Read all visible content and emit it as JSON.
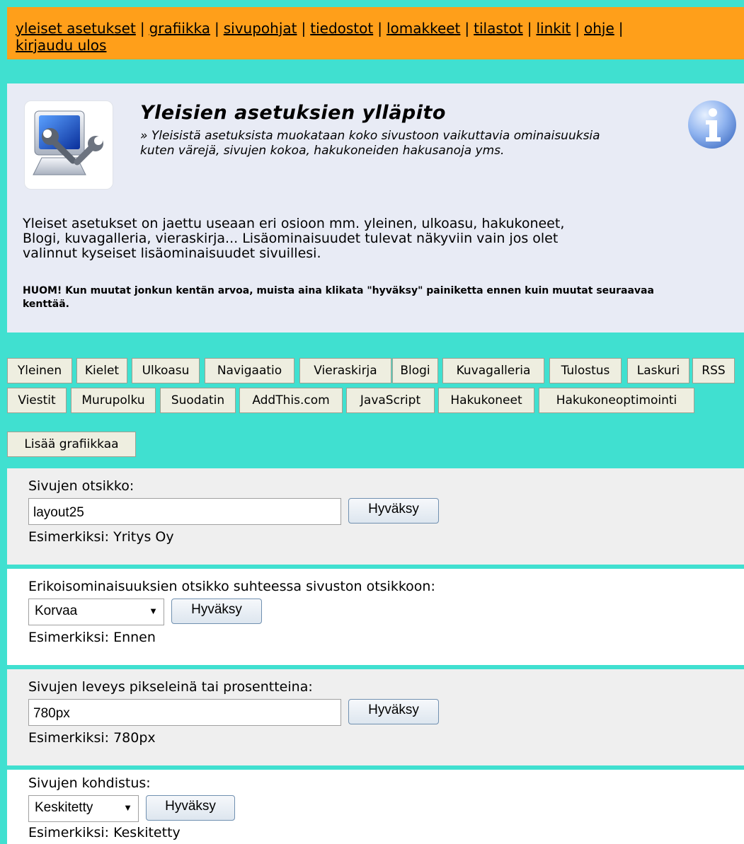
{
  "nav": {
    "links": [
      "yleiset asetukset",
      "grafiikka",
      "sivupohjat",
      "tiedostot",
      "lomakkeet",
      "tilastot",
      "linkit",
      "ohje",
      "kirjaudu ulos"
    ],
    "separator": "|"
  },
  "intro": {
    "title": "Yleisien asetuksien ylläpito",
    "subtitle": "» Yleisistä asetuksista muokataan koko sivustoon vaikuttavia ominaisuuksia kuten värejä, sivujen kokoa, hakukoneiden hakusanoja yms.",
    "body": "Yleiset asetukset on jaettu useaan eri osioon mm. yleinen, ulkoasu, hakukoneet, Blogi, kuvagalleria, vieraskirja... Lisäominaisuudet tulevat näkyviin vain jos olet valinnut kyseiset lisäominaisuudet sivuillesi.",
    "note": "HUOM! Kun muutat jonkun kentän arvoa, muista aina klikata \"hyväksy\" painiketta ennen kuin muutat seuraavaa kenttää."
  },
  "tabs": [
    "Yleinen",
    "Kielet",
    "Ulkoasu",
    "Navigaatio",
    "Vieraskirja",
    "Blogi",
    "Kuvagalleria",
    "Tulostus",
    "Laskuri",
    "RSS",
    "Viestit",
    "Murupolku",
    "Suodatin",
    "AddThis.com",
    "JavaScript",
    "Hakukoneet",
    "Hakukoneoptimointi",
    "Lisää grafiikkaa"
  ],
  "settings": [
    {
      "label": "Sivujen otsikko:",
      "type": "text",
      "value": "layout25",
      "button": "Hyväksy",
      "example": "Esimerkiksi: Yritys Oy"
    },
    {
      "label": "Erikoisominaisuuksien otsikko suhteessa sivuston otsikkoon:",
      "type": "select",
      "value": "Korvaa",
      "button": "Hyväksy",
      "example": "Esimerkiksi: Ennen"
    },
    {
      "label": "Sivujen leveys pikseleinä tai prosentteina:",
      "type": "text",
      "value": "780px",
      "button": "Hyväksy",
      "example": "Esimerkiksi: 780px"
    },
    {
      "label": "Sivujen kohdistus:",
      "type": "select",
      "value": "Keskitetty",
      "button": "Hyväksy",
      "example": "Esimerkiksi: Keskitetty"
    }
  ],
  "colors": {
    "background": "#40e0d0",
    "nav": "#ff9f1a",
    "intro": "#e8ebf5",
    "tab": "#eeeee0",
    "section_grey": "#efefef"
  },
  "icons": {
    "app": "settings-computer-wrench-icon",
    "info": "info-icon",
    "select": "chevron-down-icon"
  }
}
